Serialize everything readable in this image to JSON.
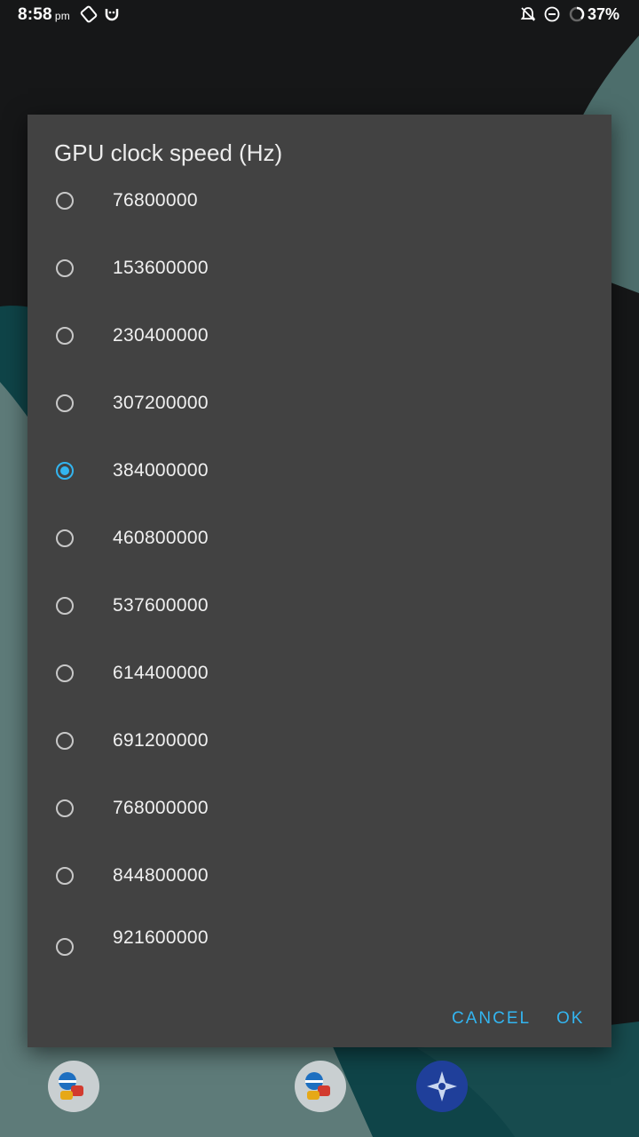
{
  "status_bar": {
    "time": "8:58",
    "ampm": "pm",
    "battery": "37%",
    "left_icons": [
      "screen-rotation-icon",
      "face-icon"
    ],
    "right_icons": [
      "notifications-off-icon",
      "do-not-disturb-icon",
      "battery-icon"
    ]
  },
  "dialog": {
    "title": "GPU clock speed (Hz)",
    "options": [
      {
        "label": "76800000",
        "checked": false
      },
      {
        "label": "153600000",
        "checked": false
      },
      {
        "label": "230400000",
        "checked": false
      },
      {
        "label": "307200000",
        "checked": false
      },
      {
        "label": "384000000",
        "checked": true
      },
      {
        "label": "460800000",
        "checked": false
      },
      {
        "label": "537600000",
        "checked": false
      },
      {
        "label": "614400000",
        "checked": false
      },
      {
        "label": "691200000",
        "checked": false
      },
      {
        "label": "768000000",
        "checked": false
      },
      {
        "label": "844800000",
        "checked": false
      },
      {
        "label": "921600000",
        "checked": false
      }
    ],
    "cancel_label": "CANCEL",
    "ok_label": "OK"
  },
  "colors": {
    "accent": "#33b5f0",
    "dialog_bg": "#424242"
  },
  "dock": {
    "icons": [
      "app-icon-1",
      "app-icon-2",
      "compass-app-icon"
    ]
  }
}
